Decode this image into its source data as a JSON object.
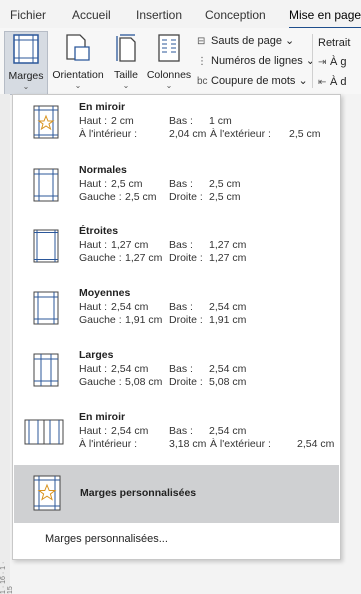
{
  "tabs": [
    "Fichier",
    "Accueil",
    "Insertion",
    "Conception",
    "Mise en page"
  ],
  "ribbon": {
    "buttons": [
      {
        "label": "Marges",
        "icon": "margins-icon"
      },
      {
        "label": "Orientation",
        "icon": "orientation-icon"
      },
      {
        "label": "Taille",
        "icon": "page-size-icon"
      },
      {
        "label": "Colonnes",
        "icon": "columns-icon"
      }
    ],
    "chevron": "⌄",
    "setup_items": [
      {
        "label": "Sauts de page",
        "suffix": "⌄"
      },
      {
        "label": "Numéros de lignes",
        "suffix": "⌄"
      },
      {
        "label": "Coupure de mots",
        "suffix": "⌄"
      }
    ],
    "retrait": {
      "label": "Retrait",
      "rows": [
        "À g",
        "À d"
      ]
    }
  },
  "margins_menu": {
    "items": [
      {
        "title": "En miroir",
        "icon": "mirror-margin-star-icon",
        "r1": [
          "Haut :",
          "2 cm",
          "Bas :",
          "1 cm",
          "",
          ""
        ],
        "r2": [
          "À l'intérieur :",
          "2,04 cm",
          "À l'extérieur :",
          "2,5 cm",
          "",
          ""
        ]
      },
      {
        "title": "Normales",
        "icon": "normal-margin-icon",
        "r1": [
          "Haut :",
          "2,5 cm",
          "Bas :",
          "2,5 cm"
        ],
        "r2": [
          "Gauche :",
          "2,5 cm",
          "Droite :",
          "2,5 cm"
        ]
      },
      {
        "title": "Étroites",
        "icon": "narrow-margin-icon",
        "r1": [
          "Haut :",
          "1,27 cm",
          "Bas :",
          "1,27 cm"
        ],
        "r2": [
          "Gauche :",
          "1,27 cm",
          "Droite :",
          "1,27 cm"
        ]
      },
      {
        "title": "Moyennes",
        "icon": "moderate-margin-icon",
        "r1": [
          "Haut :",
          "2,54 cm",
          "Bas :",
          "2,54 cm"
        ],
        "r2": [
          "Gauche :",
          "1,91 cm",
          "Droite :",
          "1,91 cm"
        ]
      },
      {
        "title": "Larges",
        "icon": "wide-margin-icon",
        "r1": [
          "Haut :",
          "2,54 cm",
          "Bas :",
          "2,54 cm"
        ],
        "r2": [
          "Gauche :",
          "5,08 cm",
          "Droite :",
          "5,08 cm"
        ]
      },
      {
        "title": "En miroir",
        "icon": "mirrored-pages-icon",
        "r1": [
          "Haut :",
          "2,54 cm",
          "Bas :",
          "2,54 cm"
        ],
        "r2": [
          "À l'intérieur :",
          "3,18 cm",
          "À l'extérieur :",
          "2,54 cm"
        ]
      }
    ],
    "custom_item": {
      "title": "Marges personnalisées",
      "icon": "custom-margin-star-icon"
    },
    "footer": "Marges personnalisées..."
  },
  "ruler_text": "1 · 16 · 1 · 15",
  "colors": {
    "accent": "#1e4e8c",
    "selected_bg": "#cfd0d2",
    "page_blue": "#2b579a"
  }
}
